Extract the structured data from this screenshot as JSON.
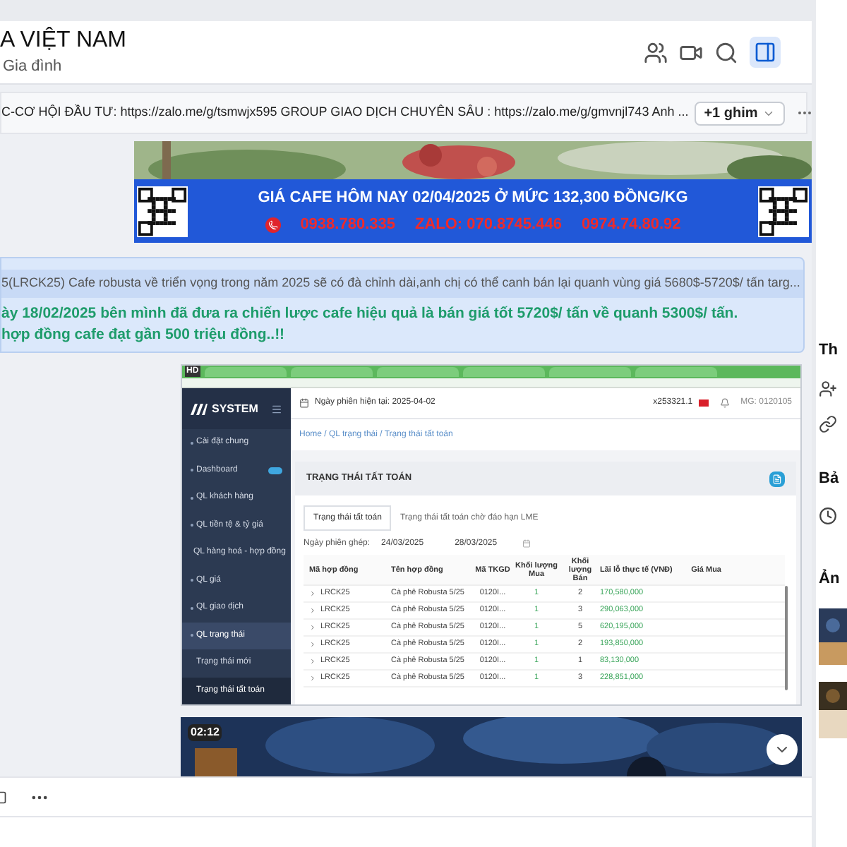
{
  "header": {
    "title": "A VIỆT NAM",
    "subtitle": "Gia đình",
    "panel_toggle": {
      "selected": true
    }
  },
  "pinned": {
    "text": "C-CƠ HỘI ĐẦU TƯ: https://zalo.me/g/tsmwjx595 GROUP GIAO DỊCH CHUYÊN SÂU : https://zalo.me/g/gmvnjl743 Anh ...",
    "more_label": "+1 ghim"
  },
  "banner": {
    "headline": "GIÁ CAFE HÔM NAY 02/04/2025 Ở MỨC 132,300 ĐỒNG/KG",
    "phones": [
      "0938.780.335",
      "ZALO: 070.8745.446",
      "0974.74.80.92"
    ]
  },
  "message": {
    "quote": "5(LRCK25) Cafe robusta về triển vọng trong năm 2025 sẽ có đà chỉnh dài,anh chị có thể canh bán lại quanh vùng giá 5680$-5720$/ tấn targ...",
    "lines": [
      "ày 18/02/2025 bên mình đã đưa ra chiến lược cafe hiệu quả là bán giá tốt 5720$/ tấn về quanh 5300$/ tấn.",
      "hợp đồng cafe đạt gần 500 triệu đồng..!!"
    ]
  },
  "screenshot": {
    "corner_label": "HD",
    "logo": "SYSTEM",
    "sidebar": [
      {
        "label": "Cài đặt chung",
        "expanded": false
      },
      {
        "label": "Dashboard",
        "badge": true,
        "expanded": false
      },
      {
        "label": "QL khách hàng",
        "expanded": false
      },
      {
        "label": "QL tiền tệ & tỷ giá",
        "expanded": false
      },
      {
        "label": "QL hàng hoá - hợp đồng",
        "expanded": false
      },
      {
        "label": "QL giá",
        "expanded": false
      },
      {
        "label": "QL giao dịch",
        "expanded": false
      },
      {
        "label": "QL trạng thái",
        "expanded": true,
        "children": [
          {
            "label": "Trạng thái mới",
            "selected": false
          },
          {
            "label": "Trạng thái tất toán",
            "selected": true
          }
        ]
      }
    ],
    "session_date": "Ngày phiên hiện tại: 2025-04-02",
    "account": "x253321.1",
    "user": "MG: 0120105",
    "breadcrumb": "Home / QL trạng thái / Trạng thái tất toán",
    "card_title": "TRẠNG THÁI TẤT TOÁN",
    "tabs": [
      {
        "label": "Trạng thái tất toán",
        "selected": true
      },
      {
        "label": "Trạng thái tất toán chờ đáo hạn LME",
        "selected": false
      }
    ],
    "filter": {
      "label": "Ngày phiên ghép:",
      "from": "24/03/2025",
      "to": "28/03/2025"
    },
    "table": {
      "columns": [
        "Mã hợp đồng",
        "Tên hợp đồng",
        "Mã TKGD",
        "Khối lượng Mua",
        "Khối lượng Bán",
        "Lãi lỗ thực tế (VNĐ)",
        "Giá Mua"
      ],
      "rows": [
        [
          "LRCK25",
          "Cà phê Robusta 5/25",
          "0120I...",
          "1",
          "2",
          "170,580,000"
        ],
        [
          "LRCK25",
          "Cà phê Robusta 5/25",
          "0120I...",
          "1",
          "3",
          "290,063,000"
        ],
        [
          "LRCK25",
          "Cà phê Robusta 5/25",
          "0120I...",
          "1",
          "5",
          "620,195,000"
        ],
        [
          "LRCK25",
          "Cà phê Robusta 5/25",
          "0120I...",
          "1",
          "2",
          "193,850,000"
        ],
        [
          "LRCK25",
          "Cà phê Robusta 5/25",
          "0120I...",
          "1",
          "1",
          "83,130,000"
        ],
        [
          "LRCK25",
          "Cà phê Robusta 5/25",
          "0120I...",
          "1",
          "3",
          "228,851,000"
        ]
      ]
    }
  },
  "video": {
    "duration": "02:12"
  },
  "right_panel": {
    "sections": [
      "Th",
      "Bả",
      "Ản"
    ]
  }
}
